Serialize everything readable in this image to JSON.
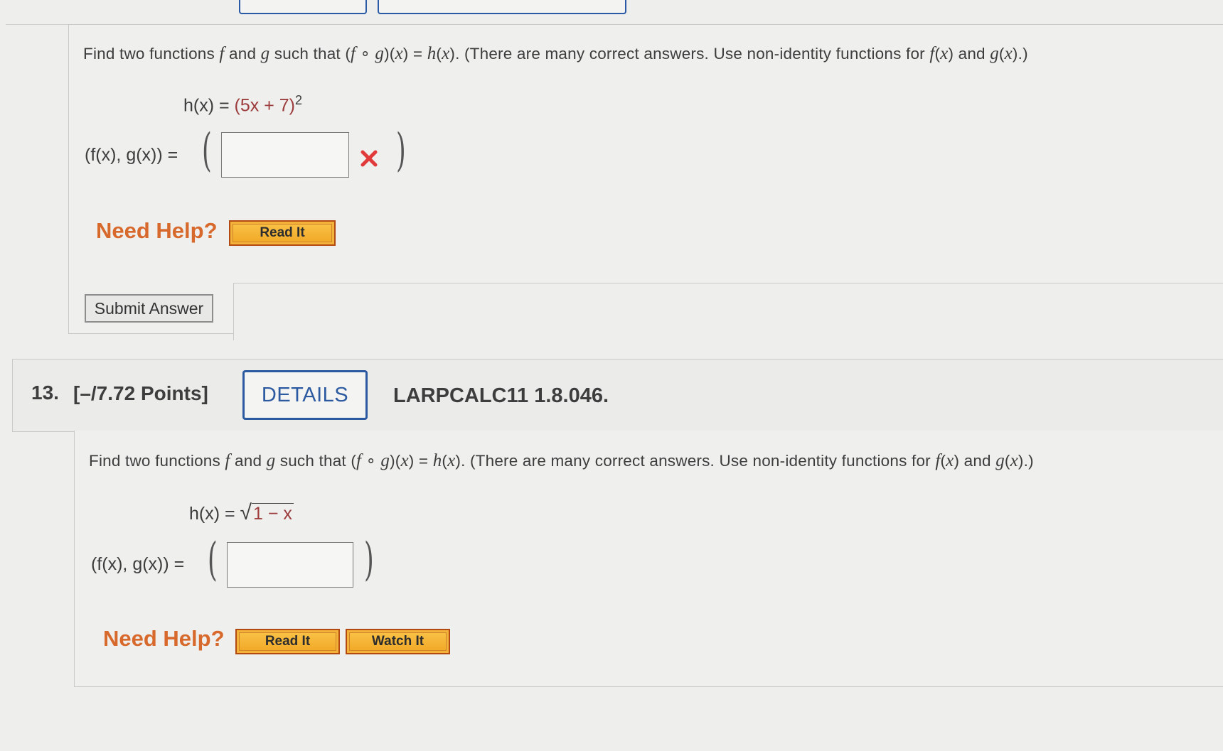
{
  "prev_question": {
    "prompt_parts": [
      "Find two functions ",
      "f",
      " and ",
      "g",
      " such that (",
      "f",
      " ∘ ",
      "g",
      ")(",
      "x",
      ") = ",
      "h",
      "(",
      "x",
      "). (There are many correct answers. Use non-identity functions for ",
      "f",
      "(",
      "x",
      ") and ",
      "g",
      "(",
      "x",
      ").)"
    ],
    "h_lhs": "h(x) = ",
    "h_rhs": "(5x + 7)",
    "h_exp": "2",
    "answer_label": "(f(x), g(x)) =",
    "answer_value": "",
    "answer_status": "incorrect",
    "status_icon": "x-mark-icon",
    "status_color": "#e03a3a",
    "need_help": "Need Help?",
    "read_it": "Read It",
    "submit": "Submit Answer"
  },
  "question": {
    "number": "13.",
    "points": "[–/7.72 Points]",
    "details": "DETAILS",
    "reference": "LARPCALC11 1.8.046.",
    "h_lhs": "h(x) = ",
    "h_radicand": "1 − x",
    "answer_label": "(f(x), g(x)) =",
    "answer_value": "",
    "need_help": "Need Help?",
    "read_it": "Read It",
    "watch_it": "Watch It"
  },
  "colors": {
    "help_orange": "#d8692c",
    "details_blue": "#2c5aa0",
    "math_red": "#9c3c3c"
  }
}
